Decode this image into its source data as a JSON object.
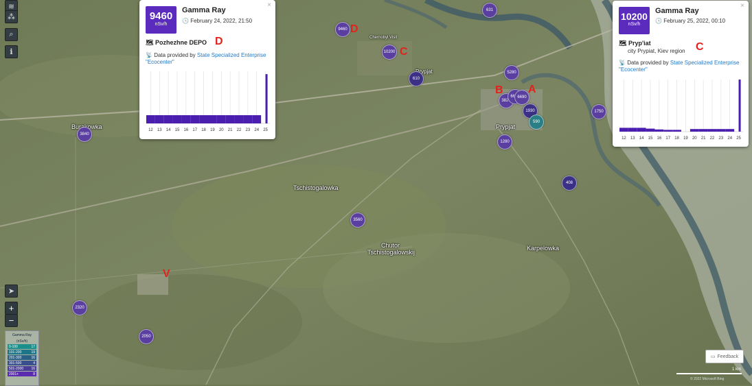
{
  "map": {
    "places": {
      "burakowka": "Burakowka",
      "tschistogalowka": "Tschistogalowka",
      "chutor_1": "Chutor",
      "chutor_2": "Tschistogalowskij",
      "karpelowka": "Karpelowka",
      "prypjat_top": "Prypjat",
      "prypjat_city": "Prypjat",
      "chernobyl_visit": "Chernobyl Visit"
    },
    "markers": {
      "m_top": "631",
      "m_d": "9460",
      "m_c": "10200",
      "m_610": "610",
      "m_5280": "5280",
      "m_b1": "3820",
      "m_b2": "6690",
      "m_a": "6690",
      "m_1930": "1930",
      "m_teal": "590",
      "m_1750": "1750",
      "m_1280": "1280",
      "m_408": "408",
      "m_3840": "3840",
      "m_3560": "3560",
      "m_2320": "2320",
      "m_2050": "2050"
    },
    "annotations": {
      "a": "A",
      "b": "B",
      "c1": "C",
      "c2": "C",
      "d1": "D",
      "d2": "D",
      "v": "V"
    },
    "colors": {
      "marker": "#5a3fa0",
      "marker_low": "#2a7f86",
      "annotation": "#e3221d"
    }
  },
  "controls": {
    "layers_icon": "layers-icon",
    "network_icon": "network-icon",
    "search_icon": "search-icon",
    "info_icon": "info-icon",
    "locate_icon": "locate-arrow-icon",
    "zoom_in": "+",
    "zoom_out": "−"
  },
  "legend": {
    "title": "Gamma Ray",
    "unit": "(nSv/h)",
    "rows": [
      {
        "range": "0-100",
        "count": "17"
      },
      {
        "range": "101-200",
        "count": "19"
      },
      {
        "range": "201-300",
        "count": "16"
      },
      {
        "range": "301-500",
        "count": "4"
      },
      {
        "range": "501-2000",
        "count": "16"
      },
      {
        "range": "2001+",
        "count": "8"
      }
    ]
  },
  "popup_left": {
    "value": "9460",
    "unit": "nSv/h",
    "title": "Gamma Ray",
    "date": "February 24, 2022, 21:50",
    "location": "Pozhezhne DEPO",
    "provider_prefix": "Data provided by ",
    "provider_link": "State Specialized Enterprise \"Ecocenter\"",
    "close": "×"
  },
  "popup_right": {
    "value": "10200",
    "unit": "nSv/h",
    "title": "Gamma Ray",
    "date": "February 25, 2022, 00:10",
    "location": "Pryp'iat",
    "sublocation": "city Prypiat, Kiev region",
    "provider_prefix": "Data provided by ",
    "provider_link": "State Specialized Enterprise \"Ecocenter\"",
    "close": "×"
  },
  "chart_data": [
    {
      "type": "bar",
      "categories": [
        "12",
        "13",
        "14",
        "15",
        "16",
        "17",
        "18",
        "19",
        "20",
        "21",
        "22",
        "23",
        "24",
        "25"
      ],
      "values": [
        1,
        1,
        1,
        1,
        1,
        1,
        1,
        1,
        1,
        1,
        1,
        1,
        1,
        9460
      ],
      "ylim": [
        0,
        10000
      ]
    },
    {
      "type": "bar",
      "categories": [
        "12",
        "13",
        "14",
        "15",
        "16",
        "17",
        "18",
        "19",
        "20",
        "21",
        "22",
        "23",
        "24",
        "25"
      ],
      "values": [
        0.6,
        0.6,
        0.6,
        0.4,
        0.2,
        0.1,
        0.1,
        0,
        0.3,
        0.3,
        0.3,
        0.3,
        0.3,
        10200
      ],
      "ylim": [
        0,
        10200
      ]
    }
  ],
  "footer": {
    "feedback": "Feedback",
    "scale": "1 km",
    "attribution": "© 2022 Microsoft Bing"
  }
}
